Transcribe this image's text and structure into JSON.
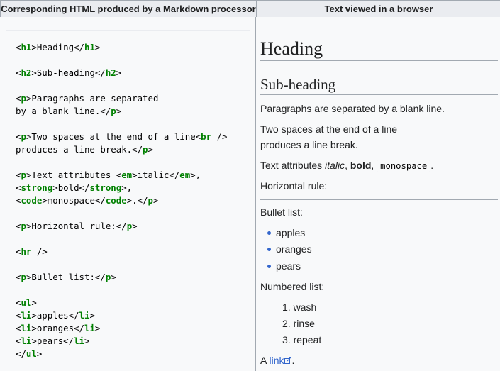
{
  "headers": {
    "left": "Corresponding HTML produced by a Markdown processor",
    "right": "Text viewed in a browser"
  },
  "code_lines": [
    [
      [
        "t",
        "<"
      ],
      [
        "g",
        "h1"
      ],
      [
        "t",
        ">Heading</"
      ],
      [
        "g",
        "h1"
      ],
      [
        "t",
        ">"
      ]
    ],
    [],
    [
      [
        "t",
        "<"
      ],
      [
        "g",
        "h2"
      ],
      [
        "t",
        ">Sub-heading</"
      ],
      [
        "g",
        "h2"
      ],
      [
        "t",
        ">"
      ]
    ],
    [],
    [
      [
        "t",
        "<"
      ],
      [
        "g",
        "p"
      ],
      [
        "t",
        ">Paragraphs are separated"
      ]
    ],
    [
      [
        "t",
        "by a blank line.</"
      ],
      [
        "g",
        "p"
      ],
      [
        "t",
        ">"
      ]
    ],
    [],
    [
      [
        "t",
        "<"
      ],
      [
        "g",
        "p"
      ],
      [
        "t",
        ">Two spaces at the end of a line<"
      ],
      [
        "g",
        "br"
      ],
      [
        "t",
        " />"
      ]
    ],
    [
      [
        "t",
        "produces a line break.</"
      ],
      [
        "g",
        "p"
      ],
      [
        "t",
        ">"
      ]
    ],
    [],
    [
      [
        "t",
        "<"
      ],
      [
        "g",
        "p"
      ],
      [
        "t",
        ">Text attributes <"
      ],
      [
        "g",
        "em"
      ],
      [
        "t",
        ">italic</"
      ],
      [
        "g",
        "em"
      ],
      [
        "t",
        ">,"
      ]
    ],
    [
      [
        "t",
        "<"
      ],
      [
        "g",
        "strong"
      ],
      [
        "t",
        ">bold</"
      ],
      [
        "g",
        "strong"
      ],
      [
        "t",
        ">,"
      ]
    ],
    [
      [
        "t",
        "<"
      ],
      [
        "g",
        "code"
      ],
      [
        "t",
        ">monospace</"
      ],
      [
        "g",
        "code"
      ],
      [
        "t",
        ">.</"
      ],
      [
        "g",
        "p"
      ],
      [
        "t",
        ">"
      ]
    ],
    [],
    [
      [
        "t",
        "<"
      ],
      [
        "g",
        "p"
      ],
      [
        "t",
        ">Horizontal rule:</"
      ],
      [
        "g",
        "p"
      ],
      [
        "t",
        ">"
      ]
    ],
    [],
    [
      [
        "t",
        "<"
      ],
      [
        "g",
        "hr"
      ],
      [
        "t",
        " />"
      ]
    ],
    [],
    [
      [
        "t",
        "<"
      ],
      [
        "g",
        "p"
      ],
      [
        "t",
        ">Bullet list:</"
      ],
      [
        "g",
        "p"
      ],
      [
        "t",
        ">"
      ]
    ],
    [],
    [
      [
        "t",
        "<"
      ],
      [
        "g",
        "ul"
      ],
      [
        "t",
        ">"
      ]
    ],
    [
      [
        "t",
        "<"
      ],
      [
        "g",
        "li"
      ],
      [
        "t",
        ">apples</"
      ],
      [
        "g",
        "li"
      ],
      [
        "t",
        ">"
      ]
    ],
    [
      [
        "t",
        "<"
      ],
      [
        "g",
        "li"
      ],
      [
        "t",
        ">oranges</"
      ],
      [
        "g",
        "li"
      ],
      [
        "t",
        ">"
      ]
    ],
    [
      [
        "t",
        "<"
      ],
      [
        "g",
        "li"
      ],
      [
        "t",
        ">pears</"
      ],
      [
        "g",
        "li"
      ],
      [
        "t",
        ">"
      ]
    ],
    [
      [
        "t",
        "</"
      ],
      [
        "g",
        "ul"
      ],
      [
        "t",
        ">"
      ]
    ]
  ],
  "rendered": {
    "heading": "Heading",
    "subheading": "Sub-heading",
    "para1": "Paragraphs are separated by a blank line.",
    "para2_line1": "Two spaces at the end of a line",
    "para2_line2": "produces a line break.",
    "attr_prefix": "Text attributes ",
    "italic": "italic",
    "comma1": ", ",
    "bold": "bold",
    "comma2": ", ",
    "monospace": "monospace",
    "period": ".",
    "hr_label": "Horizontal rule:",
    "bullet_label": "Bullet list:",
    "bullets": [
      "apples",
      "oranges",
      "pears"
    ],
    "numbered_label": "Numbered list:",
    "numbered": [
      "1. wash",
      "2. rinse",
      "3. repeat"
    ],
    "link_prefix": "A ",
    "link_text": "link",
    "link_suffix": ".",
    "link_color": "#3366cc",
    "tag_color": "#008000"
  }
}
